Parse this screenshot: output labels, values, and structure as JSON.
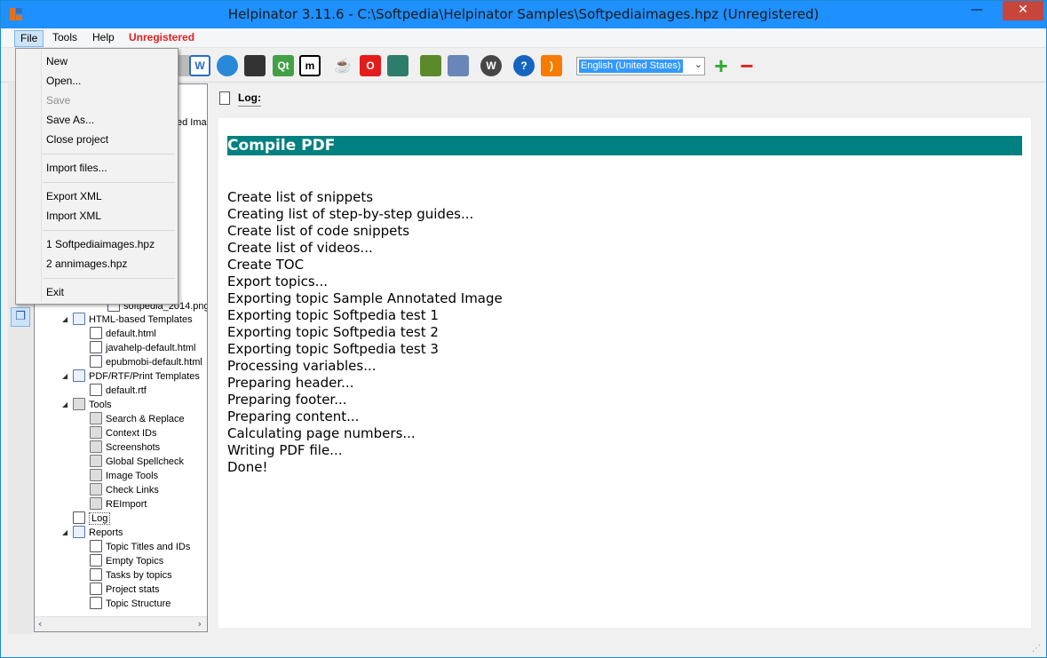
{
  "window": {
    "title": "Helpinator 3.11.6 - C:\\Softpedia\\Helpinator Samples\\Softpediaimages.hpz (Unregistered)",
    "minimize": "—",
    "maximize": "",
    "close": "✕"
  },
  "menubar": {
    "file": "File",
    "tools": "Tools",
    "help": "Help",
    "unregistered": "Unregistered"
  },
  "file_menu": {
    "items": [
      {
        "label": "New",
        "enabled": true
      },
      {
        "label": "Open...",
        "enabled": true
      },
      {
        "label": "Save",
        "enabled": false
      },
      {
        "label": "Save As...",
        "enabled": true
      },
      {
        "label": "Close project",
        "enabled": true
      },
      {
        "label": "Import files...",
        "enabled": true
      },
      {
        "label": "Export XML",
        "enabled": true
      },
      {
        "label": "Import XML",
        "enabled": true
      },
      {
        "label": "1 Softpediaimages.hpz",
        "enabled": true
      },
      {
        "label": "2 annimages.hpz",
        "enabled": true
      },
      {
        "label": "Exit",
        "enabled": true
      }
    ]
  },
  "toolbar": {
    "icons": [
      "word-icon",
      "globe-icon",
      "printer-icon",
      "qt-icon",
      "m-icon",
      "java-icon",
      "opera-icon",
      "book-icon",
      "epub-icon",
      "mobile-icon",
      "wordpress-icon",
      "help-icon",
      "rss-icon"
    ],
    "language_value": "English (United States)",
    "add_label": "+",
    "remove_label": "−"
  },
  "tree": {
    "partial_top": "ed Imag",
    "softpedia_file": "softpedia_2014.png",
    "items": [
      {
        "label": "HTML-based Templates",
        "level": 1,
        "icon": "folder"
      },
      {
        "label": "default.html",
        "level": 2,
        "icon": "doc"
      },
      {
        "label": "javahelp-default.html",
        "level": 2,
        "icon": "doc"
      },
      {
        "label": "epubmobi-default.html",
        "level": 2,
        "icon": "doc"
      },
      {
        "label": "PDF/RTF/Print Templates",
        "level": 1,
        "icon": "folder"
      },
      {
        "label": "default.rtf",
        "level": 2,
        "icon": "doc"
      },
      {
        "label": "Tools",
        "level": 1,
        "icon": "tool"
      },
      {
        "label": "Search & Replace",
        "level": 2,
        "icon": "tool"
      },
      {
        "label": "Context IDs",
        "level": 2,
        "icon": "tool"
      },
      {
        "label": "Screenshots",
        "level": 2,
        "icon": "tool"
      },
      {
        "label": "Global Spellcheck",
        "level": 2,
        "icon": "tool"
      },
      {
        "label": "Image Tools",
        "level": 2,
        "icon": "tool"
      },
      {
        "label": "Check Links",
        "level": 2,
        "icon": "tool"
      },
      {
        "label": "REImport",
        "level": 2,
        "icon": "tool"
      },
      {
        "label": "Log",
        "level": 1,
        "icon": "doc",
        "selected": true
      },
      {
        "label": "Reports",
        "level": 1,
        "icon": "folder"
      },
      {
        "label": "Topic Titles and IDs",
        "level": 2,
        "icon": "doc"
      },
      {
        "label": "Empty Topics",
        "level": 2,
        "icon": "doc"
      },
      {
        "label": "Tasks by topics",
        "level": 2,
        "icon": "doc"
      },
      {
        "label": "Project stats",
        "level": 2,
        "icon": "doc"
      },
      {
        "label": "Topic Structure",
        "level": 2,
        "icon": "doc"
      }
    ]
  },
  "main": {
    "tab_label": "Log:",
    "log_header": "Compile PDF",
    "log_lines": [
      "Create list of snippets",
      "Creating list of step-by-step guides...",
      "Create list of code snippets",
      "Create list of videos...",
      "Create TOC",
      "Export topics...",
      "Exporting topic Sample Annotated Image",
      "Exporting topic Softpedia test 1",
      "Exporting topic Softpedia test 2",
      "Exporting topic Softpedia test 3",
      "Processing variables...",
      "Preparing header...",
      "Preparing footer...",
      "Preparing content...",
      "Calculating page numbers...",
      "Writing PDF file...",
      "Done!"
    ]
  },
  "colors": {
    "titlebar": "#1e90ff",
    "log_header_bg": "#008080",
    "unregistered": "#e02020"
  }
}
